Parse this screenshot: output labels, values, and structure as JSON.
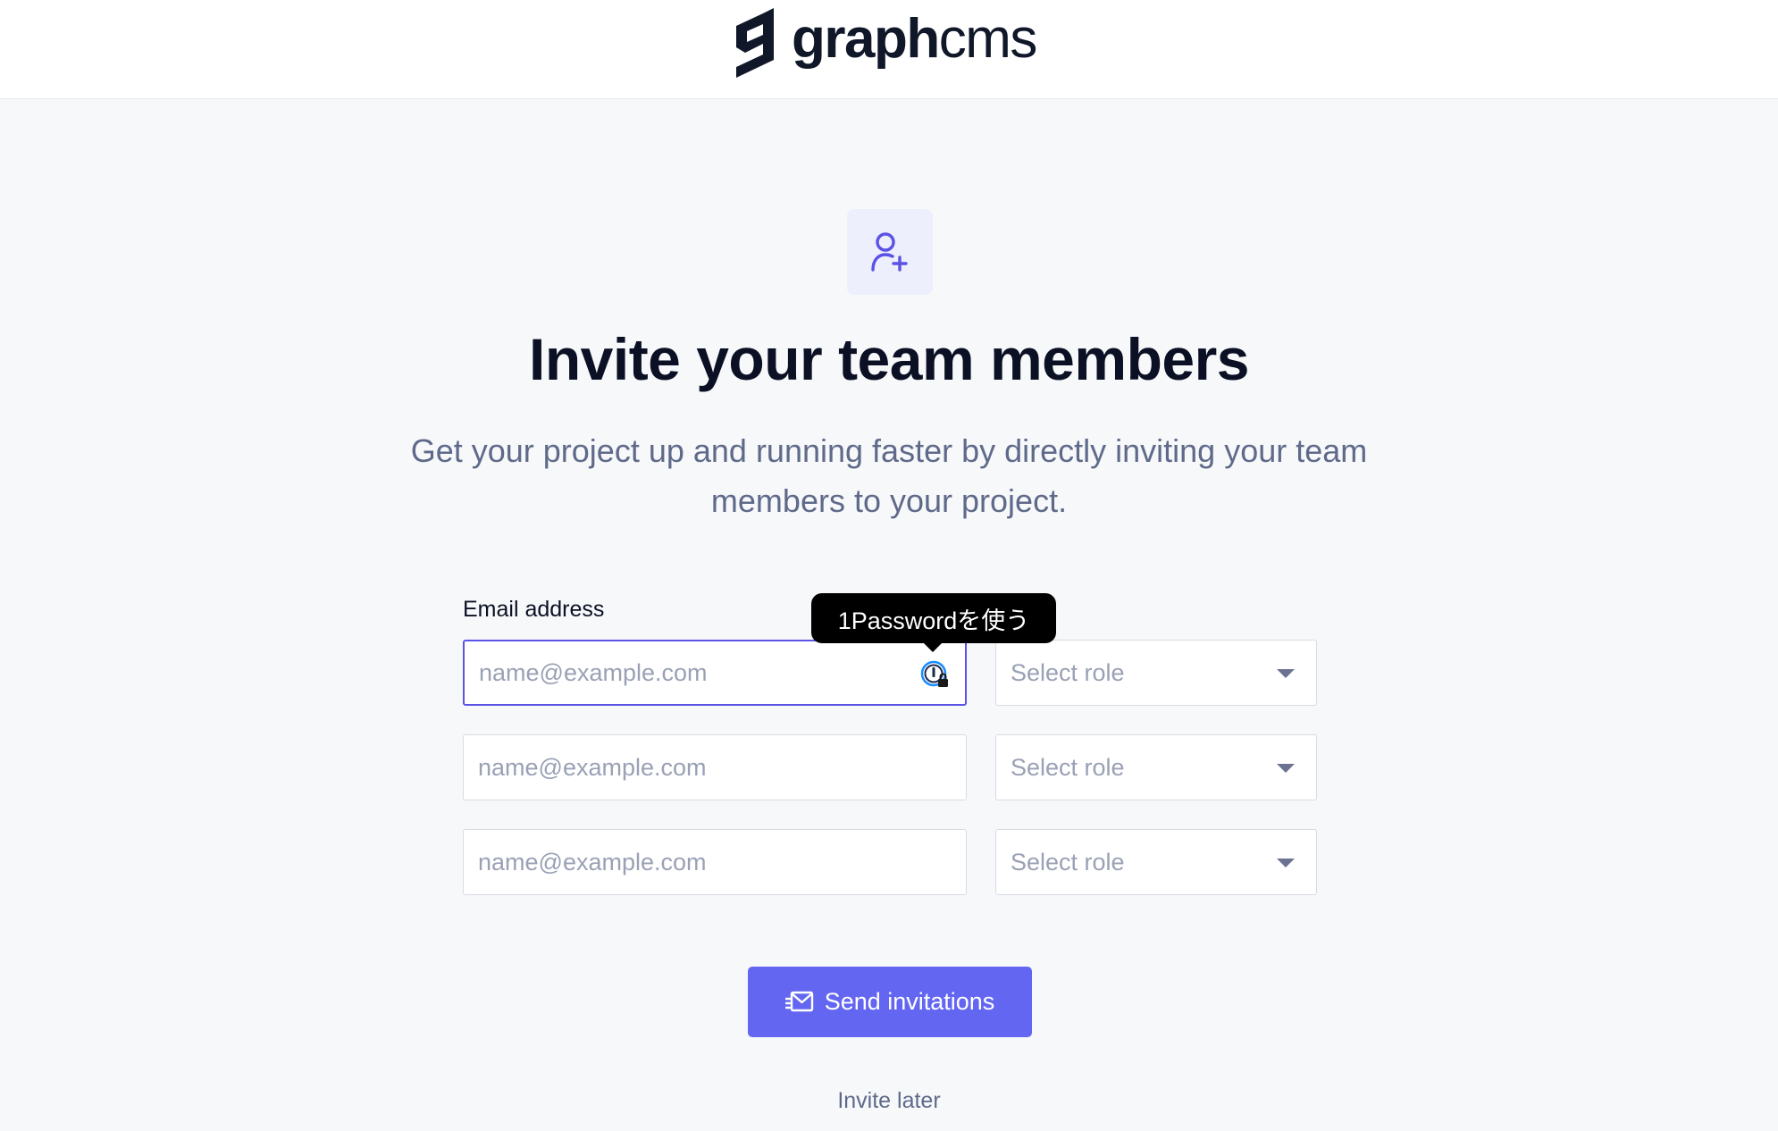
{
  "header": {
    "logo_bold": "graph",
    "logo_light": "cms"
  },
  "hero": {
    "icon": "user-plus-icon",
    "title": "Invite your team members",
    "subtitle": "Get your project up and running faster by directly inviting your team members to your project."
  },
  "form": {
    "email_label": "Email address",
    "rows": [
      {
        "email_placeholder": "name@example.com",
        "role_value": "Select role"
      },
      {
        "email_placeholder": "name@example.com",
        "role_value": "Select role"
      },
      {
        "email_placeholder": "name@example.com",
        "role_value": "Select role"
      }
    ],
    "password_manager_icon": "1password-icon",
    "tooltip": "1Passwordを使う"
  },
  "actions": {
    "send_label": "Send invitations",
    "send_icon": "envelope-send-icon",
    "later_label": "Invite later"
  },
  "colors": {
    "accent": "#6366f1",
    "focus_border": "#5b52e6",
    "title": "#0b1024",
    "muted": "#5f6a8a"
  }
}
